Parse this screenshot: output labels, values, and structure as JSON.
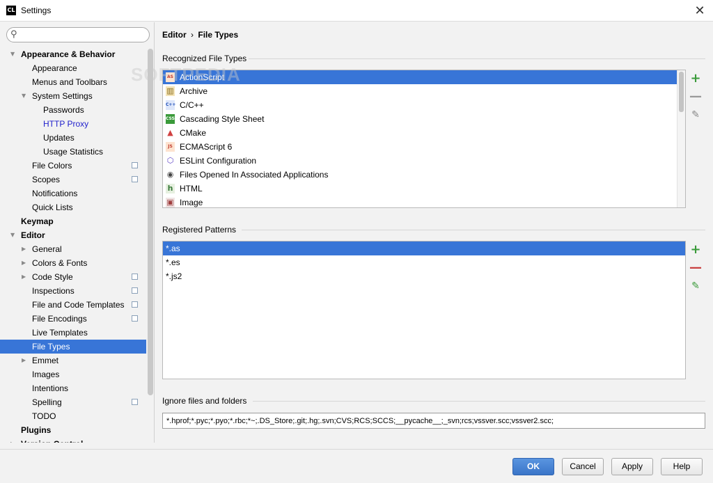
{
  "window": {
    "app_icon": "CL",
    "title": "Settings",
    "close_glyph": "✕"
  },
  "search": {
    "placeholder": "",
    "icon": "search-icon",
    "value": ""
  },
  "tree": [
    {
      "label": "Appearance & Behavior",
      "level": 0,
      "arrow": "expanded",
      "bold": true
    },
    {
      "label": "Appearance",
      "level": 1
    },
    {
      "label": "Menus and Toolbars",
      "level": 1
    },
    {
      "label": "System Settings",
      "level": 1,
      "arrow": "expanded"
    },
    {
      "label": "Passwords",
      "level": 2
    },
    {
      "label": "HTTP Proxy",
      "level": 2,
      "link": true
    },
    {
      "label": "Updates",
      "level": 2
    },
    {
      "label": "Usage Statistics",
      "level": 2
    },
    {
      "label": "File Colors",
      "level": 1,
      "copy": true
    },
    {
      "label": "Scopes",
      "level": 1,
      "copy": true
    },
    {
      "label": "Notifications",
      "level": 1
    },
    {
      "label": "Quick Lists",
      "level": 1
    },
    {
      "label": "Keymap",
      "level": 0,
      "bold": true
    },
    {
      "label": "Editor",
      "level": 0,
      "arrow": "expanded",
      "bold": true
    },
    {
      "label": "General",
      "level": 1,
      "arrow": "collapsed"
    },
    {
      "label": "Colors & Fonts",
      "level": 1,
      "arrow": "collapsed"
    },
    {
      "label": "Code Style",
      "level": 1,
      "arrow": "collapsed",
      "copy": true
    },
    {
      "label": "Inspections",
      "level": 1,
      "copy": true
    },
    {
      "label": "File and Code Templates",
      "level": 1,
      "copy": true
    },
    {
      "label": "File Encodings",
      "level": 1,
      "copy": true
    },
    {
      "label": "Live Templates",
      "level": 1
    },
    {
      "label": "File Types",
      "level": 1,
      "selected": true
    },
    {
      "label": "Emmet",
      "level": 1,
      "arrow": "collapsed"
    },
    {
      "label": "Images",
      "level": 1
    },
    {
      "label": "Intentions",
      "level": 1
    },
    {
      "label": "Spelling",
      "level": 1,
      "copy": true
    },
    {
      "label": "TODO",
      "level": 1
    },
    {
      "label": "Plugins",
      "level": 0,
      "bold": true
    },
    {
      "label": "Version Control",
      "level": 0,
      "arrow": "collapsed",
      "bold": true
    }
  ],
  "breadcrumb": {
    "parent": "Editor",
    "separator": "›",
    "current": "File Types"
  },
  "recognized": {
    "label": "Recognized File Types",
    "items": [
      {
        "name": "ActionScript",
        "icon": "actionscript-icon",
        "glyph": "AS",
        "color": "#c0392b",
        "bg": "#fde3d0",
        "selected": true
      },
      {
        "name": "Archive",
        "icon": "archive-icon",
        "glyph": "▥",
        "color": "#8a6d1e",
        "bg": "#f4e4b8"
      },
      {
        "name": "C/C++",
        "icon": "cpp-icon",
        "glyph": "C++",
        "color": "#1f4fb8",
        "bg": "#dde6fa"
      },
      {
        "name": "Cascading Style Sheet",
        "icon": "css-icon",
        "glyph": "CSS",
        "color": "#ffffff",
        "bg": "#3a9a3a"
      },
      {
        "name": "CMake",
        "icon": "cmake-icon",
        "glyph": "▲",
        "color": "#d04040",
        "bg": "transparent"
      },
      {
        "name": "ECMAScript 6",
        "icon": "ecmascript-icon",
        "glyph": "JS",
        "color": "#c0392b",
        "bg": "#fde3d0"
      },
      {
        "name": "ESLint Configuration",
        "icon": "eslint-icon",
        "glyph": "⬡",
        "color": "#5b3fc4",
        "bg": "transparent"
      },
      {
        "name": "Files Opened In Associated Applications",
        "icon": "associated-app-icon",
        "glyph": "◉",
        "color": "#444444",
        "bg": "transparent"
      },
      {
        "name": "HTML",
        "icon": "html-icon",
        "glyph": "h",
        "color": "#3a7a3a",
        "bg": "#e6f0e0"
      },
      {
        "name": "Image",
        "icon": "image-icon",
        "glyph": "▣",
        "color": "#a04040",
        "bg": "#f0e4e4"
      }
    ]
  },
  "patterns": {
    "label": "Registered Patterns",
    "items": [
      {
        "value": "*.as",
        "selected": true
      },
      {
        "value": "*.es"
      },
      {
        "value": "*.js2"
      }
    ]
  },
  "tools": {
    "add": "+",
    "remove": "—",
    "edit": "✎"
  },
  "ignore": {
    "label": "Ignore files and folders",
    "value": "*.hprof;*.pyc;*.pyo;*.rbc;*~;.DS_Store;.git;.hg;.svn;CVS;RCS;SCCS;__pycache__;_svn;rcs;vssver.scc;vssver2.scc;"
  },
  "watermark": "SOFTPEDIA",
  "buttons": {
    "ok": "OK",
    "cancel": "Cancel",
    "apply": "Apply",
    "help": "Help"
  }
}
